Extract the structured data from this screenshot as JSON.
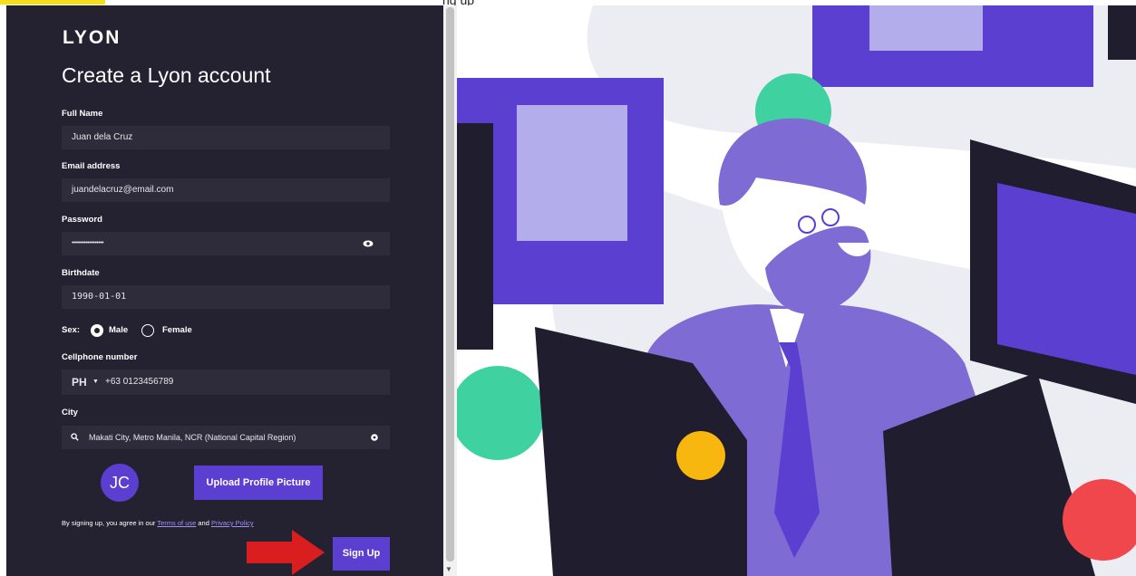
{
  "top_text": "ng up",
  "logo": "LYON",
  "title": "Create a Lyon account",
  "form": {
    "full_name": {
      "label": "Full Name",
      "value": "Juan dela Cruz"
    },
    "email": {
      "label": "Email address",
      "value": "juandelacruz@email.com"
    },
    "password": {
      "label": "Password",
      "value": "••••••••••••••••••"
    },
    "birthdate": {
      "label": "Birthdate",
      "value": "1990-01-01"
    },
    "sex": {
      "label": "Sex:",
      "options": [
        "Male",
        "Female"
      ],
      "selected": "Male"
    },
    "cellphone": {
      "label": "Cellphone number",
      "country": "PH",
      "value": "+63 0123456789"
    },
    "city": {
      "label": "City",
      "value": "Makati City, Metro Manila, NCR (National Capital Region)"
    }
  },
  "avatar_initials": "JC",
  "upload_label": "Upload Profile Picture",
  "terms": {
    "prefix": "By signing up, you agree in our ",
    "terms_link": "Terms of use",
    "and": " and ",
    "privacy_link": "Privacy Policy"
  },
  "signup_label": "Sign Up",
  "colors": {
    "panel": "#242230",
    "field": "#2e2c3b",
    "accent": "#5b3fd0",
    "arrow": "#d81e1e",
    "highlight": "#f5e11b"
  }
}
